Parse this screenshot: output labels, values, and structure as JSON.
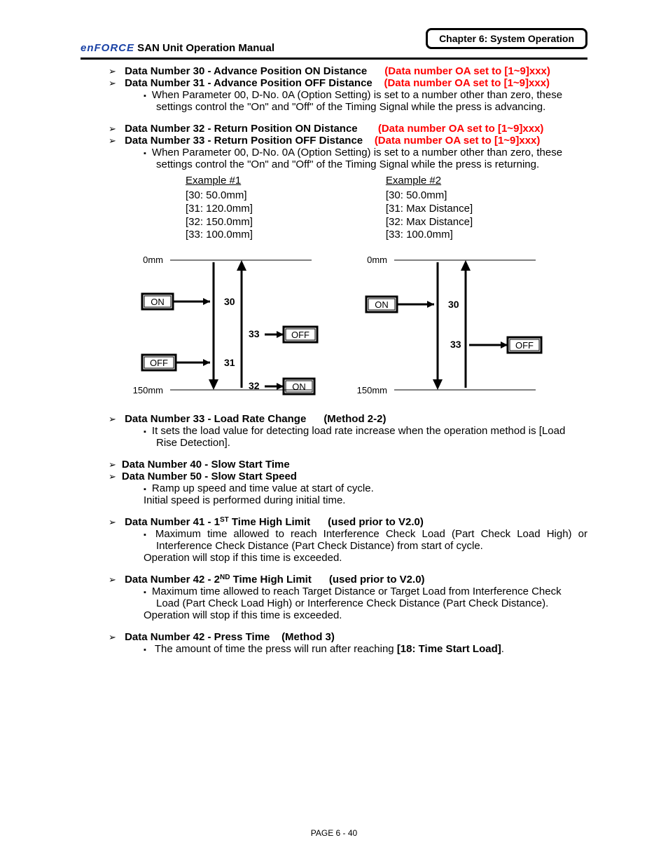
{
  "header": {
    "chapter": "Chapter 6: System Operation",
    "logo": "enFORCE",
    "title": " SAN  Unit  Operation  Manual"
  },
  "items": {
    "d30": "Data Number 30 - Advance Position ON Distance",
    "d30r": "(Data number OA set to [1~9]xxx)",
    "d31": "Data Number 31 - Advance Position OFF Distance",
    "d31r": "(Data number OA set to [1~9]xxx)",
    "d30note": "When Parameter 00, D-No. 0A (Option Setting) is set to a number other than zero, these settings control the \"On\" and \"Off\" of the Timing Signal while the press is advancing.",
    "d32": "Data Number 32 - Return Position ON Distance",
    "d32r": "(Data number OA set to [1~9]xxx)",
    "d33": "Data Number 33 - Return Position OFF Distance",
    "d33r": "(Data number OA set to [1~9]xxx)",
    "d32note": "When Parameter 00, D-No. 0A (Option Setting) is set to a number other than zero, these settings control the \"On\" and \"Off\" of the Timing Signal while the press is returning.",
    "d33b": "Data Number 33 - Load Rate Change",
    "d33bm": "(Method 2-2)",
    "d33bnote": "It sets the load value for detecting load rate increase when the operation method is [Load Rise Detection].",
    "d40": "Data Number 40 - Slow Start Time",
    "d50": "Data Number 50 - Slow Start Speed",
    "d4050note1": "Ramp up speed and time value at start of cycle.",
    "d4050note2": "Initial speed is performed during initial time.",
    "d41a": "Data Number 41 - 1",
    "d41b": " Time High Limit",
    "d41c": "(used prior to V2.0)",
    "d41note1": "Maximum time allowed to reach Interference Check Load (Part Check Load High) or Interference Check Distance (Part Check Distance) from start of cycle.",
    "d41note2": "Operation will stop if this time is exceeded.",
    "d42a": "Data Number 42 - 2",
    "d42b": " Time High Limit",
    "d42c": "(used prior to V2.0)",
    "d42note1": "Maximum time allowed to reach Target Distance or Target Load from Interference Check Load (Part Check Load High) or Interference Check Distance (Part Check Distance).",
    "d42note2": "Operation will stop if this time is exceeded.",
    "d42p": "Data Number 42 - Press Time",
    "d42pm": "(Method 3)",
    "d42pnote1": "The amount of time the press will run after reaching ",
    "d42pnote2": "[18: Time Start Load]",
    "d42pnote3": "."
  },
  "examples": {
    "e1": {
      "title": "Example #1",
      "v1": "[30: 50.0mm]",
      "v2": "[31: 120.0mm]",
      "v3": "[32: 150.0mm]",
      "v4": "[33: 100.0mm]"
    },
    "e2": {
      "title": "Example #2",
      "v1": "[30: 50.0mm]",
      "v2": "[31: Max Distance]",
      "v3": "[32: Max Distance]",
      "v4": "[33: 100.0mm]"
    }
  },
  "diagram": {
    "top": "0mm",
    "bottom": "150mm",
    "on": "ON",
    "off": "OFF",
    "n30": "30",
    "n31": "31",
    "n32": "32",
    "n33": "33"
  },
  "footer": "PAGE 6 - 40",
  "chart_data": [
    {
      "type": "diagram",
      "name": "Example #1",
      "top_label": "0mm",
      "bottom_label": "150mm",
      "advance": {
        "on_at": "30",
        "off_at": "31"
      },
      "return": {
        "on_at": "32",
        "off_at": "33"
      },
      "values": {
        "30": "50.0mm",
        "31": "120.0mm",
        "32": "150.0mm",
        "33": "100.0mm"
      }
    },
    {
      "type": "diagram",
      "name": "Example #2",
      "top_label": "0mm",
      "bottom_label": "150mm",
      "advance": {
        "on_at": "30"
      },
      "return": {
        "off_at": "33"
      },
      "values": {
        "30": "50.0mm",
        "31": "Max Distance",
        "32": "Max Distance",
        "33": "100.0mm"
      }
    }
  ]
}
